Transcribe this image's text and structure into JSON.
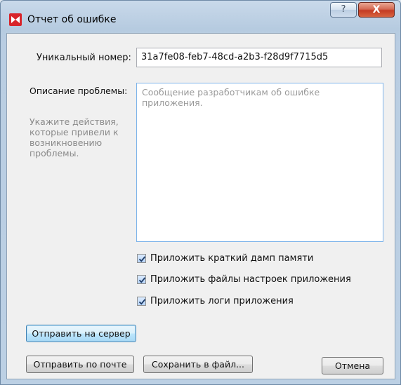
{
  "window": {
    "title": "Отчет об ошибке",
    "help_label": "?",
    "close_label": "X"
  },
  "form": {
    "id_label": "Уникальный номер:",
    "id_value": "31a7fe08-feb7-48cd-a2b3-f28d9f7715d5",
    "description_label": "Описание проблемы:",
    "description_hint": "Укажите действия, которые привели к возникновению проблемы.",
    "description_value": "",
    "description_placeholder": "Сообщение разработчикам об ошибке приложения."
  },
  "options": [
    {
      "label": "Приложить краткий дамп памяти",
      "checked": true
    },
    {
      "label": "Приложить файлы настроек приложения",
      "checked": true
    },
    {
      "label": "Приложить логи приложения",
      "checked": true
    }
  ],
  "buttons": {
    "send_server": "Отправить на сервер",
    "send_mail": "Отправить по почте",
    "save_file": "Сохранить в файл...",
    "cancel": "Отмена"
  },
  "colors": {
    "accent": "#d8242a",
    "close_button": "#c43b22",
    "focus_border": "#3c7fb1"
  }
}
